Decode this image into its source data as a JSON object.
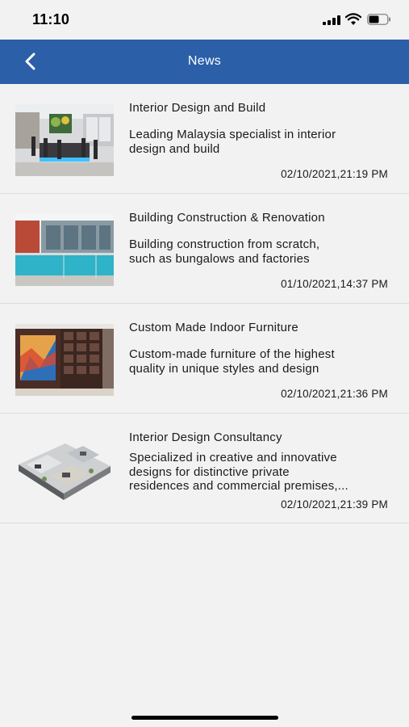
{
  "status_bar": {
    "time": "11:10",
    "icons": [
      "signal-icon",
      "wifi-icon",
      "battery-icon"
    ]
  },
  "nav": {
    "title": "News",
    "back_icon": "chevron-left-icon"
  },
  "news_items": [
    {
      "title": "Interior Design and Build",
      "description": " Leading Malaysia specialist in interior\ndesign and build",
      "datetime": "02/10/2021,21:19 PM"
    },
    {
      "title": "Building Construction & Renovation",
      "description": " Building construction from scratch,\nsuch as bungalows and factories",
      "datetime": "01/10/2021,14:37 PM"
    },
    {
      "title": "Custom Made Indoor Furniture",
      "description": " Custom-made furniture of the highest\nquality in unique styles and design",
      "datetime": "02/10/2021,21:36 PM"
    },
    {
      "title": "Interior Design Consultancy",
      "description": " Specialized in creative and innovative\ndesigns for distinctive private\nresidences and commercial premises,...",
      "datetime": "02/10/2021,21:39 PM"
    }
  ],
  "colors": {
    "nav_bg": "#2b5fa8",
    "page_bg": "#f2f2f2",
    "divider": "#dcdcdc"
  }
}
